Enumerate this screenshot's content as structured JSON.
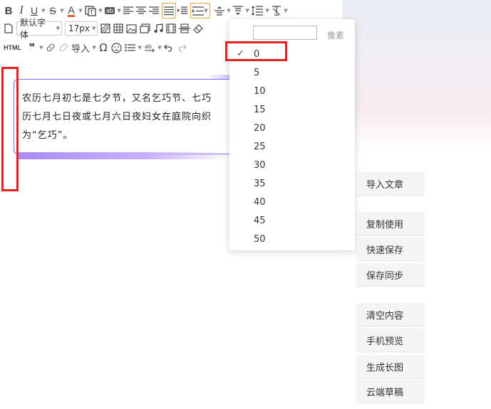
{
  "toolbar": {
    "row1": {
      "bold": "B",
      "italic": "I",
      "underline": "U",
      "strikethrough": "S",
      "font_color": "A",
      "font_color_value": "#e05a2a",
      "background_label": "ab"
    },
    "row2": {
      "font_family": "默认字体",
      "font_size": "17px"
    },
    "row3": {
      "html": "HTML",
      "quote": "❞",
      "import": "导入",
      "omega": "Ω"
    }
  },
  "editor": {
    "lines": [
      "农历七月初七是七夕节，又名乞巧节、七巧",
      "历七月七日夜或七月六日夜妇女在庭院向织",
      "为“乞巧”。"
    ]
  },
  "indent_dropdown": {
    "unit": "像素",
    "input_value": "",
    "selected_mark": "✓",
    "options": [
      "0",
      "5",
      "10",
      "15",
      "20",
      "25",
      "30",
      "35",
      "40",
      "45",
      "50"
    ]
  },
  "side_buttons": [
    "导入文章",
    "复制使用",
    "快速保存",
    "保存同步",
    "清空内容",
    "手机预览",
    "生成长图",
    "云端草稿"
  ],
  "colors": {
    "accent_border": "#7a6df0",
    "highlight_red": "#e8201c",
    "active_tool": "#e8a443"
  }
}
